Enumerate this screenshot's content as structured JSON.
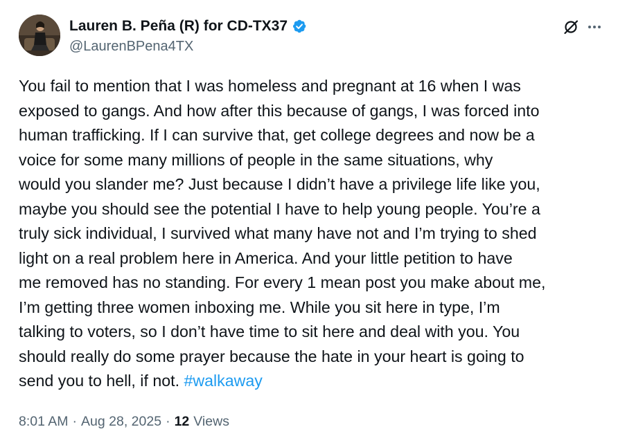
{
  "author": {
    "display_name": "Lauren B. Peña (R) for CD-TX37",
    "handle": "@LaurenBPena4TX",
    "verified": true
  },
  "icons": {
    "avatar": "profile-photo",
    "verified": "verified-badge-icon",
    "grok": "grok-icon",
    "more": "more-options-icon"
  },
  "colors": {
    "text": "#0f1419",
    "secondary": "#536471",
    "accent": "#1d9bf0"
  },
  "tweet": {
    "lines": [
      "You fail to mention that I was homeless and pregnant at 16 when I was",
      "exposed to gangs. And how after this because of gangs, I was forced into",
      "human trafficking. If I can survive that, get college degrees and now be a",
      "voice for some many millions of people in the same situations, why",
      "would you slander me? Just because I didn’t have a privilege life like you,",
      "maybe you should see the potential I have to help young people. You’re a",
      "truly sick individual, I survived what many have not and I’m trying to shed",
      "light on a real problem here in America. And your little petition to have",
      "me removed has no standing. For every 1 mean post you make about me,",
      "I’m getting three women inboxing me. While you sit here in type, I’m",
      "talking to voters, so I don’t have time to sit here and deal with you. You",
      "should really do some prayer because the hate in your heart is going to",
      "send you to hell, if not. "
    ],
    "hashtag": "#walkaway"
  },
  "meta": {
    "time": "8:01 AM",
    "separator": "·",
    "date": "Aug 28, 2025",
    "views_count": "12",
    "views_label": "Views"
  }
}
